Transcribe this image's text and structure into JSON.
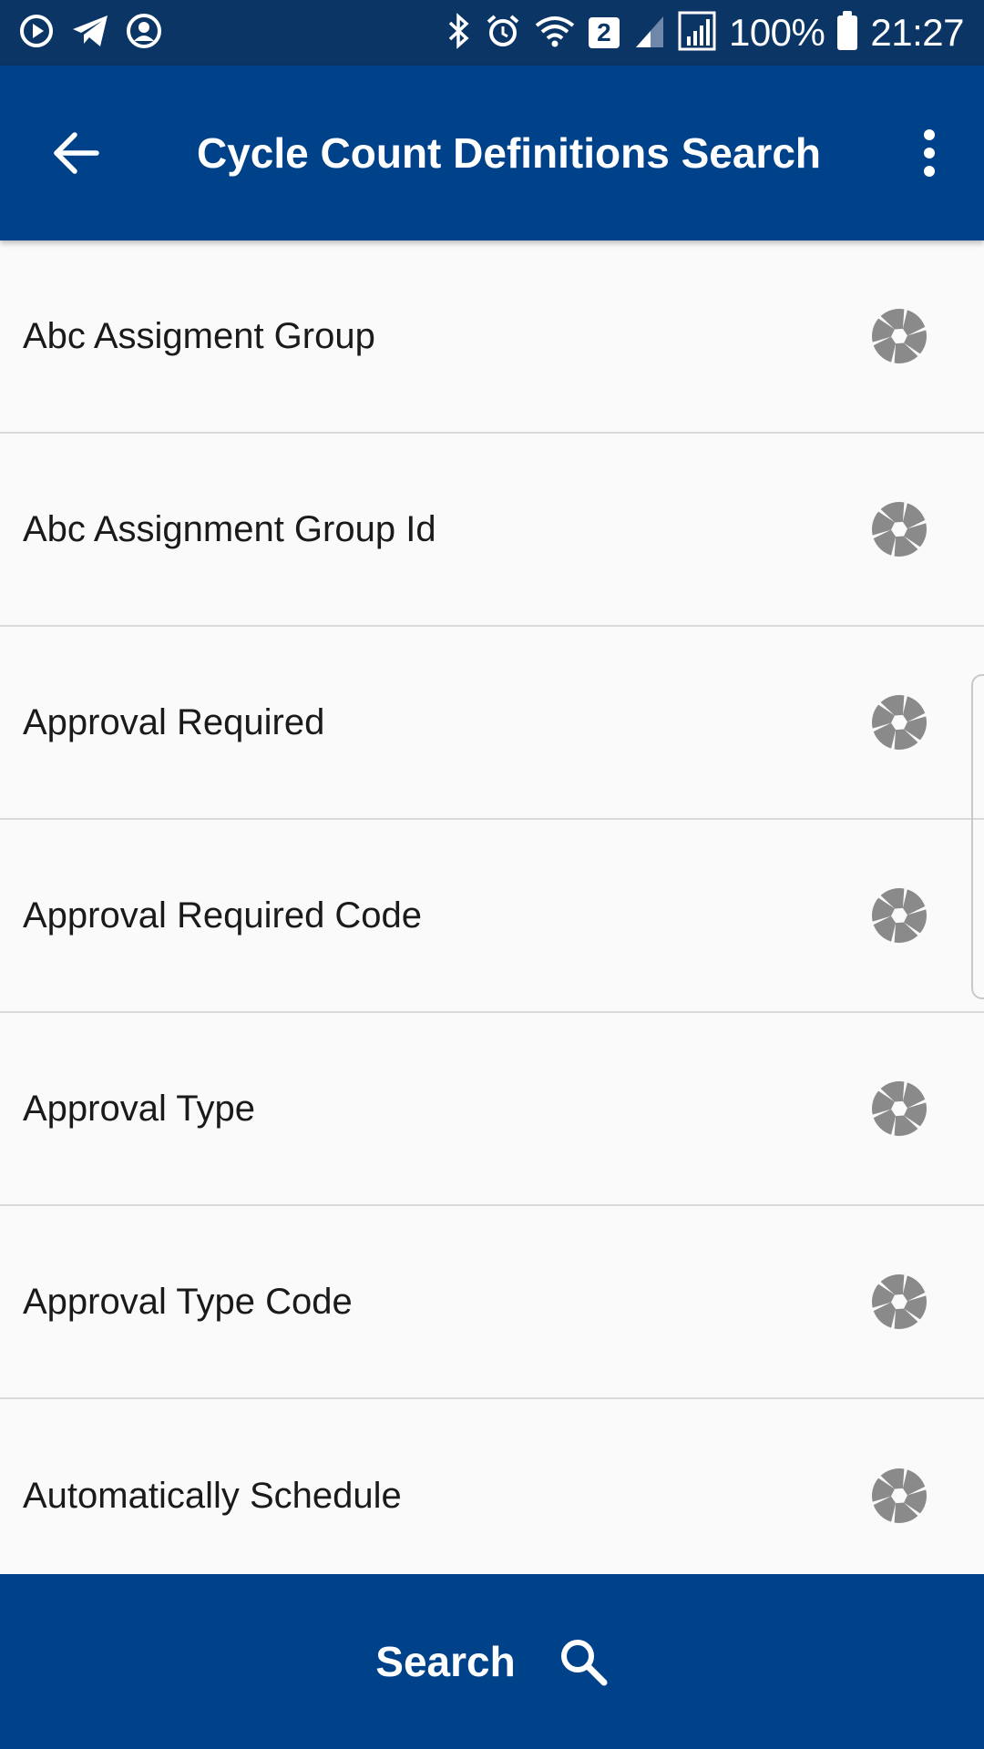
{
  "status_bar": {
    "battery": "100%",
    "time": "21:27",
    "sim_badge": "2",
    "left_icons": [
      "media-play-icon",
      "telegram-icon",
      "account-icon"
    ],
    "right_icons": [
      "bluetooth-icon",
      "alarm-icon",
      "wifi-icon",
      "sim-badge",
      "signal-icon",
      "signal-roaming-icon",
      "battery-icon"
    ]
  },
  "app_bar": {
    "title": "Cycle Count Definitions Search",
    "back_icon": "arrow-back-icon",
    "menu_icon": "more-vert-icon"
  },
  "list": {
    "items": [
      {
        "label": "Abc Assigment Group",
        "icon": "aperture-icon"
      },
      {
        "label": "Abc Assignment Group Id",
        "icon": "aperture-icon"
      },
      {
        "label": "Approval Required",
        "icon": "aperture-icon"
      },
      {
        "label": "Approval Required Code",
        "icon": "aperture-icon"
      },
      {
        "label": "Approval Type",
        "icon": "aperture-icon"
      },
      {
        "label": "Approval Type Code",
        "icon": "aperture-icon"
      },
      {
        "label": "Automatically Schedule",
        "icon": "aperture-icon"
      }
    ]
  },
  "bottom_bar": {
    "search_label": "Search",
    "search_icon": "search-icon"
  },
  "colors": {
    "status_bar": "#0b3565",
    "primary": "#004289",
    "background": "#fafafa",
    "icon_gray": "#8a8a8a",
    "divider": "#dadada"
  }
}
